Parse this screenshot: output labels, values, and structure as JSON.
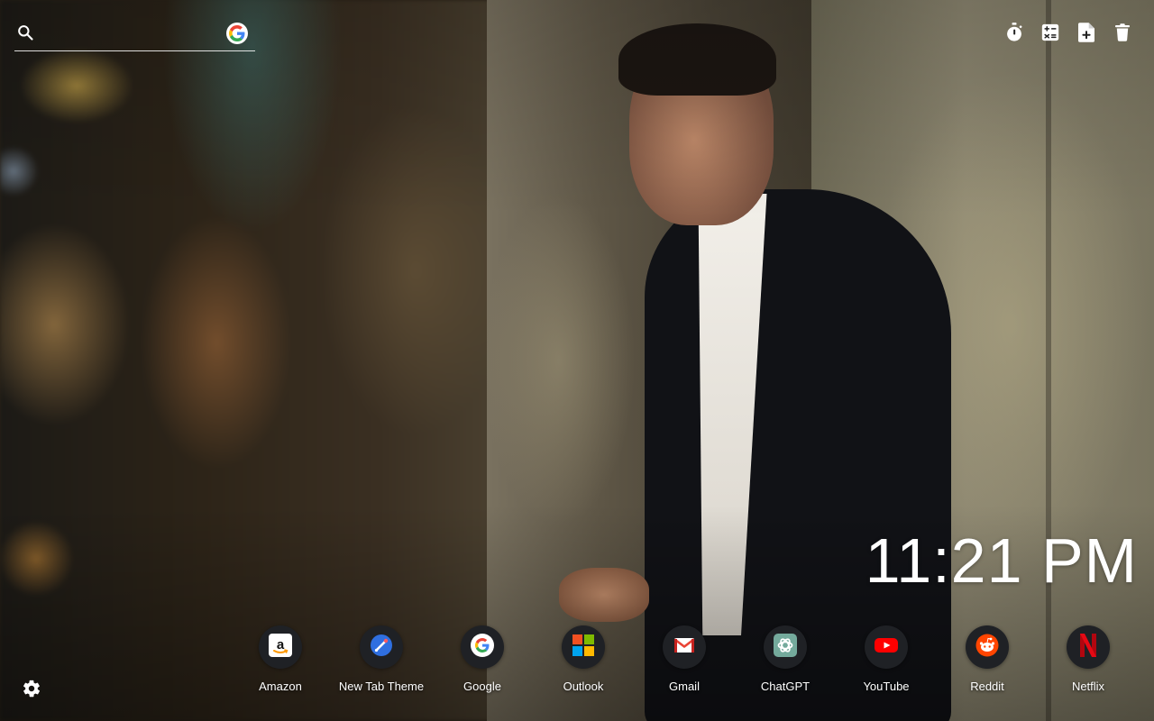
{
  "search": {
    "placeholder": ""
  },
  "tools": [
    {
      "name": "timer-icon"
    },
    {
      "name": "calculator-icon"
    },
    {
      "name": "new-note-icon"
    },
    {
      "name": "trash-icon"
    }
  ],
  "clock": {
    "time": "11:21 PM"
  },
  "shortcuts": [
    {
      "label": "Amazon",
      "icon": "amazon-icon"
    },
    {
      "label": "New Tab Theme",
      "icon": "new-tab-theme-icon"
    },
    {
      "label": "Google",
      "icon": "google-icon"
    },
    {
      "label": "Outlook",
      "icon": "outlook-icon"
    },
    {
      "label": "Gmail",
      "icon": "gmail-icon"
    },
    {
      "label": "ChatGPT",
      "icon": "chatgpt-icon"
    },
    {
      "label": "YouTube",
      "icon": "youtube-icon"
    },
    {
      "label": "Reddit",
      "icon": "reddit-icon"
    },
    {
      "label": "Netflix",
      "icon": "netflix-icon"
    }
  ],
  "colors": {
    "youtube": "#FF0000",
    "netflix": "#E50914",
    "reddit": "#FF4500",
    "new_tab_theme": "#2F6FE0",
    "chatgpt": "#74AA9C"
  }
}
